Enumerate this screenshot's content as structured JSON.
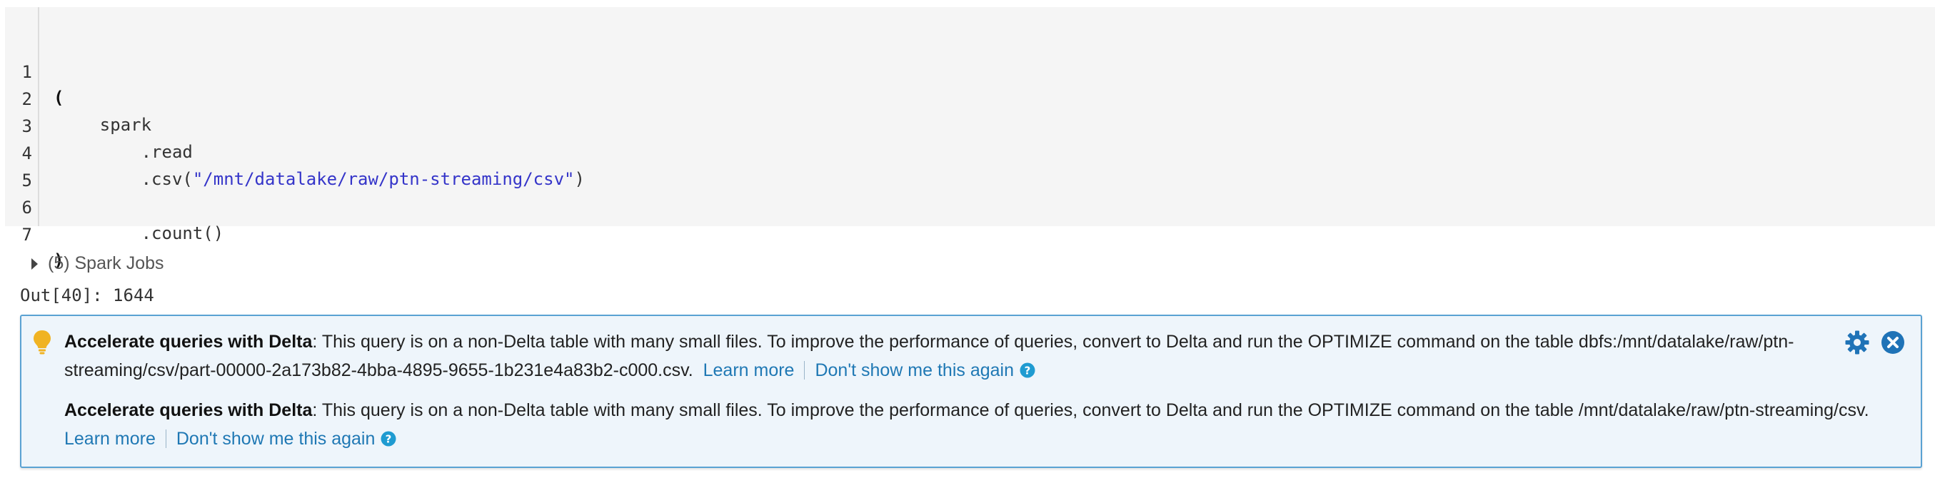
{
  "code_cell": {
    "lines": [
      {
        "no": "1",
        "pre": "(",
        "str": "",
        "post": ""
      },
      {
        "no": "2",
        "pre": "    spark",
        "str": "",
        "post": ""
      },
      {
        "no": "3",
        "pre": "        .read",
        "str": "",
        "post": ""
      },
      {
        "no": "4",
        "pre": "        .csv(",
        "str": "\"/mnt/datalake/raw/ptn-streaming/csv\"",
        "post": ")"
      },
      {
        "no": "5",
        "pre": "",
        "str": "",
        "post": ""
      },
      {
        "no": "6",
        "pre": "        .count()",
        "str": "",
        "post": ""
      },
      {
        "no": "7",
        "pre": ")",
        "str": "",
        "post": ""
      }
    ]
  },
  "spark_jobs": {
    "label": "(5) Spark Jobs"
  },
  "output": {
    "text": "Out[40]: 1644"
  },
  "notice": {
    "messages": [
      {
        "title": "Accelerate queries with Delta",
        "body": ": This query is on a non-Delta table with many small files. To improve the performance of queries, convert to Delta and run the OPTIMIZE command on the table dbfs:/mnt/datalake/raw/ptn-streaming/csv/part-00000-2a173b82-4bba-4895-9655-1b231e4a83b2-c000.csv.",
        "learn_more": "Learn more",
        "dont_show": "Don't show me this again"
      },
      {
        "title": "Accelerate queries with Delta",
        "body": ": This query is on a non-Delta table with many small files. To improve the performance of queries, convert to Delta and run the OPTIMIZE command on the table /mnt/datalake/raw/ptn-streaming/csv.",
        "learn_more": "Learn more",
        "dont_show": "Don't show me this again"
      }
    ],
    "icons": {
      "bulb": "lightbulb-icon",
      "settings": "gear-icon",
      "close": "close-icon",
      "help": "help-icon"
    }
  },
  "colors": {
    "code_bg": "#f5f5f5",
    "string": "#3535c9",
    "link": "#1f78b4",
    "notice_bg": "#eef5fb",
    "notice_border": "#5aa2d3",
    "bulb": "#f0b323",
    "icon_blue": "#1f73b7"
  }
}
